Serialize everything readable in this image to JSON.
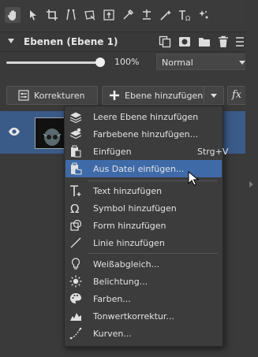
{
  "toolbar": {
    "tools": [
      "hand-icon",
      "pointer-icon",
      "crop-icon",
      "perspective-icon",
      "transform-icon",
      "text-box-icon",
      "eyedropper-icon",
      "level-icon",
      "wand-icon",
      "text-omega-icon",
      "sparkle-icon"
    ]
  },
  "layers_panel": {
    "title": "Ebenen (Ebene 1)",
    "opacity": "100%",
    "opacity_fraction": 1.0,
    "blend_mode": "Normal"
  },
  "buttons": {
    "adjustments": "Korrekturen",
    "add_layer": "Ebene hinzufügen",
    "fx": "fx"
  },
  "context_menu": {
    "items": [
      {
        "label": "Leere Ebene hinzufügen",
        "icon": "layers-plus-icon"
      },
      {
        "label": "Farbebene hinzufügen...",
        "icon": "color-layer-icon"
      },
      {
        "label": "Einfügen",
        "shortcut": "Strg+V",
        "icon": "paste-icon"
      },
      {
        "label": "Aus Datei einfügen...",
        "icon": "paste-from-file-icon",
        "highlighted": true
      },
      {
        "label": "Text hinzufügen",
        "icon": "text-add-icon"
      },
      {
        "label": "Symbol hinzufügen",
        "icon": "omega-icon"
      },
      {
        "label": "Form hinzufügen",
        "icon": "shape-icon"
      },
      {
        "label": "Linie hinzufügen",
        "icon": "line-icon"
      },
      {
        "label": "Weißabgleich...",
        "icon": "bulb-icon"
      },
      {
        "label": "Belichtung...",
        "icon": "sun-icon"
      },
      {
        "label": "Farben...",
        "icon": "palette-icon"
      },
      {
        "label": "Tonwertkorrektur...",
        "icon": "histogram-icon"
      },
      {
        "label": "Kurven...",
        "icon": "curves-icon"
      }
    ]
  },
  "colors": {
    "highlight": "#3e6aa8",
    "selected_layer": "#3a5a88",
    "panel": "#3a3a3a"
  }
}
